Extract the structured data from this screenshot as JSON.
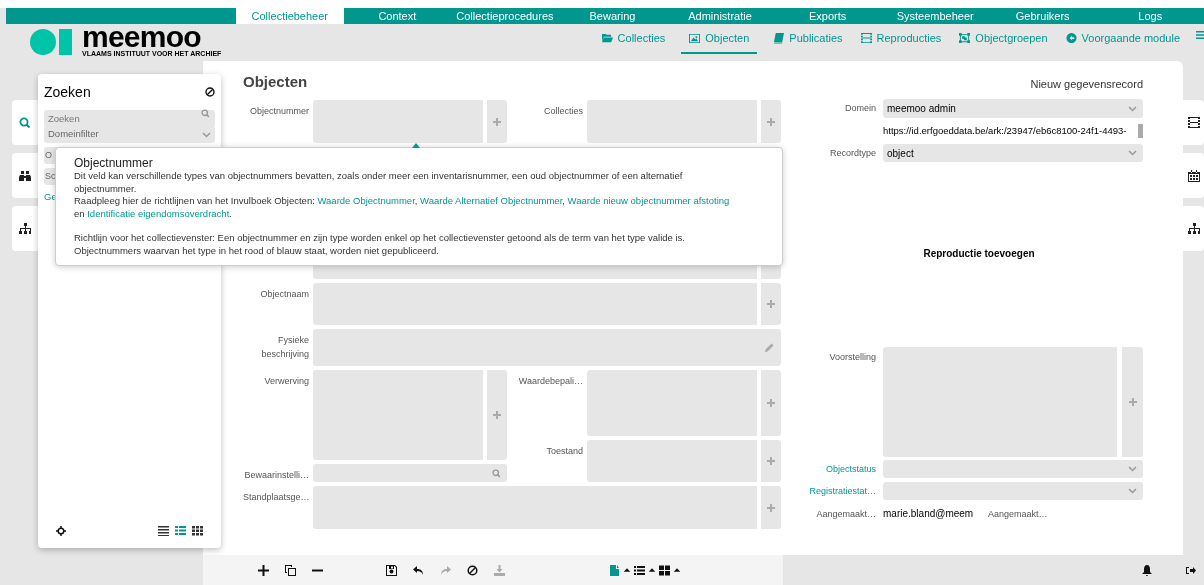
{
  "top_nav": [
    {
      "label": "Collectiebeheer",
      "selected": true
    },
    {
      "label": "Context",
      "selected": false
    },
    {
      "label": "Collectieprocedures",
      "selected": false
    },
    {
      "label": "Bewaring",
      "selected": false
    },
    {
      "label": "Administratie",
      "selected": false
    },
    {
      "label": "Exports",
      "selected": false
    },
    {
      "label": "Systeembeheer",
      "selected": false
    },
    {
      "label": "Gebruikers",
      "selected": false
    },
    {
      "label": "Logs",
      "selected": false
    }
  ],
  "logo": {
    "name": "meemoo",
    "tagline": "VLAAMS INSTITUUT VOOR HET ARCHIEF"
  },
  "module_nav": [
    {
      "label": "Collecties",
      "kind": "folder",
      "selected": false
    },
    {
      "label": "Objecten",
      "kind": "image",
      "selected": true
    },
    {
      "label": "Publicaties",
      "kind": "book",
      "selected": false
    },
    {
      "label": "Reproducties",
      "kind": "film",
      "selected": false
    },
    {
      "label": "Objectgroepen",
      "kind": "group",
      "selected": false
    },
    {
      "label": "Voorgaande module",
      "kind": "back",
      "selected": false
    }
  ],
  "left_tabs": [
    {
      "kind": "search",
      "selected": true
    },
    {
      "kind": "binoculars",
      "selected": false
    },
    {
      "kind": "sitemap",
      "selected": false
    }
  ],
  "right_tabs": [
    {
      "kind": "film"
    },
    {
      "kind": "calendar"
    },
    {
      "kind": "sitemap"
    }
  ],
  "search_panel": {
    "title": "Zoeken",
    "search_placeholder": "Zoeken",
    "domain_filter": "Domeinfilter",
    "covered_fields": [
      "O",
      "Sc"
    ],
    "covered_link": "Ge",
    "views": [
      {
        "kind": "list",
        "selected": false
      },
      {
        "kind": "details",
        "selected": true
      },
      {
        "kind": "grid",
        "selected": false
      }
    ]
  },
  "form": {
    "title": "Objecten",
    "record_state": "Nieuw gegevensrecord",
    "fields": [
      {
        "label": "Objectnummer",
        "kind": "multi"
      },
      {
        "label": "Collecties",
        "kind": "multi"
      },
      {
        "label": "Objectnaam",
        "kind": "multi"
      },
      {
        "label": "Fysieke beschrijving",
        "kind": "memo"
      },
      {
        "label": "Verwerving",
        "kind": "multi"
      },
      {
        "label": "Waardebepali…",
        "kind": "multi"
      },
      {
        "label": "Toestand",
        "kind": "multi"
      },
      {
        "label": "Bewaarinstelli…",
        "kind": "search"
      },
      {
        "label": "Standplaatsge…",
        "kind": "multi"
      }
    ],
    "domain": {
      "label": "Domein",
      "value": "meemoo admin"
    },
    "uri": "https://id.erfgoeddata.be/ark:/23947/eb6c8100-24f1-4493-",
    "record_type": {
      "label": "Recordtype",
      "value": "object"
    },
    "reproduction": "Reproductie toevoegen",
    "depiction": {
      "label": "Voorstelling"
    },
    "statuses": [
      {
        "label": "Objectstatus",
        "linked": true
      },
      {
        "label": "Registratiestat…",
        "linked": true
      }
    ],
    "created": {
      "label": "Aangemaakt…",
      "value": "marie.bland@meem",
      "label_2": "Aangemaakt…"
    }
  },
  "tooltip": {
    "title": "Objectnummer",
    "paragraphs": [
      [
        {
          "kind": "text",
          "text": "Dit veld kan verschillende types van objectnummers bevatten, zoals onder meer een inventarisnummer, een oud objectnummer of een alternatief objectnummer."
        }
      ],
      [
        {
          "kind": "text",
          "text": "Raadpleeg hier de richtlijnen van het Invulboek Objecten: "
        },
        {
          "kind": "link",
          "text": "Waarde Objectnummer"
        },
        {
          "kind": "text",
          "text": ", "
        },
        {
          "kind": "link",
          "text": "Waarde Alternatief Objectnummer"
        },
        {
          "kind": "text",
          "text": ", "
        },
        {
          "kind": "link",
          "text": "Waarde nieuw objectnummer afstoting"
        },
        {
          "kind": "text",
          "text": " en "
        },
        {
          "kind": "link",
          "text": "Identificatie eigendomsoverdracht"
        },
        {
          "kind": "text",
          "text": "."
        }
      ],
      [
        {
          "kind": "text",
          "text": "Richtlijn voor het collectievenster: Een objectnummer en zijn type worden enkel op het collectievenster getoond als de term van het type valide is. Objectnummers waarvan het type in het rood of blauw staat, worden niet gepubliceerd."
        }
      ]
    ]
  },
  "toolbar": [
    {
      "kind": "add",
      "disabled": false
    },
    {
      "kind": "copy",
      "disabled": false
    },
    {
      "kind": "remove",
      "disabled": false
    },
    {
      "kind": "save",
      "disabled": false
    },
    {
      "kind": "undo",
      "disabled": false
    },
    {
      "kind": "redo",
      "disabled": true
    },
    {
      "kind": "cancel",
      "disabled": false
    },
    {
      "kind": "download",
      "disabled": true
    },
    {
      "kind": "file",
      "disabled": false
    },
    {
      "kind": "caret",
      "disabled": false
    },
    {
      "kind": "list",
      "disabled": false
    },
    {
      "kind": "caret",
      "disabled": false
    },
    {
      "kind": "grid",
      "disabled": false
    },
    {
      "kind": "caret",
      "disabled": false
    }
  ]
}
